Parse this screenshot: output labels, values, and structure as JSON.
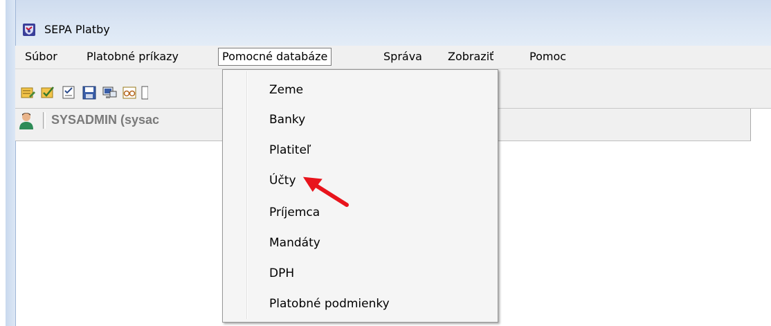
{
  "window": {
    "title": "SEPA Platby"
  },
  "menubar": {
    "items": [
      {
        "label": "Súbor"
      },
      {
        "label": "Platobné príkazy"
      },
      {
        "label": "Pomocné databáze",
        "active": true
      },
      {
        "label": "Správa"
      },
      {
        "label": "Zobraziť"
      },
      {
        "label": "Pomoc"
      }
    ]
  },
  "toolbar": {
    "icons": [
      "list-edit-icon",
      "list-check-icon",
      "checklist-icon",
      "save-icon",
      "monitor-icon",
      "glasses-icon",
      "document-icon"
    ]
  },
  "status": {
    "user": "SYSADMIN (sysac"
  },
  "dropdown": {
    "items": [
      {
        "label": "Zeme"
      },
      {
        "label": "Banky"
      },
      {
        "label": "Platiteľ"
      },
      {
        "label": "Účty",
        "highlighted": true
      },
      {
        "label": "Príjemca"
      },
      {
        "label": "Mandáty"
      },
      {
        "label": "DPH"
      },
      {
        "label": "Platobné podmienky"
      }
    ]
  },
  "colors": {
    "accent_arrow": "#e8141c",
    "titlebar": "#dbe6f4",
    "menu_bg": "#f0f0f0"
  }
}
